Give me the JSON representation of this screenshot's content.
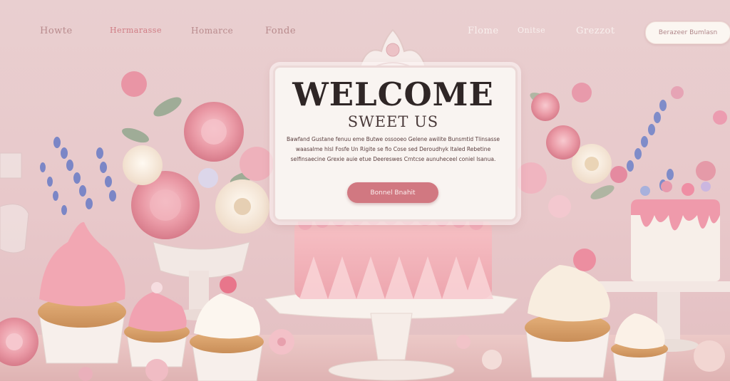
{
  "nav": {
    "left_links": [
      "Howte",
      "Hermarasse",
      "Homarce",
      "Fonde"
    ],
    "right_links": [
      "Flome",
      "Onitse",
      "Grezzot"
    ],
    "cta_label": "Berazeer Bumlasn"
  },
  "hero": {
    "title": "WELCOME",
    "subtitle": "SWEET US",
    "body": "Bawfand Gustane fenuu eme Butwe ossooeo Gelene awilite Bunsmtid Tlinsasse waasalme hlsl Fosfe Un Rigite se fio Cose sed Deroudhyk ltaled Rebetine selfinsaecine Grexie auie etue Deereswes Crntcse aunuheceel coniel lsanua.",
    "button_label": "Bonnel Bnahit"
  },
  "colors": {
    "background": "#e9cfd0",
    "card": "#f9f4f1",
    "accent": "#d17881",
    "nav_text": "#b88a8c"
  }
}
